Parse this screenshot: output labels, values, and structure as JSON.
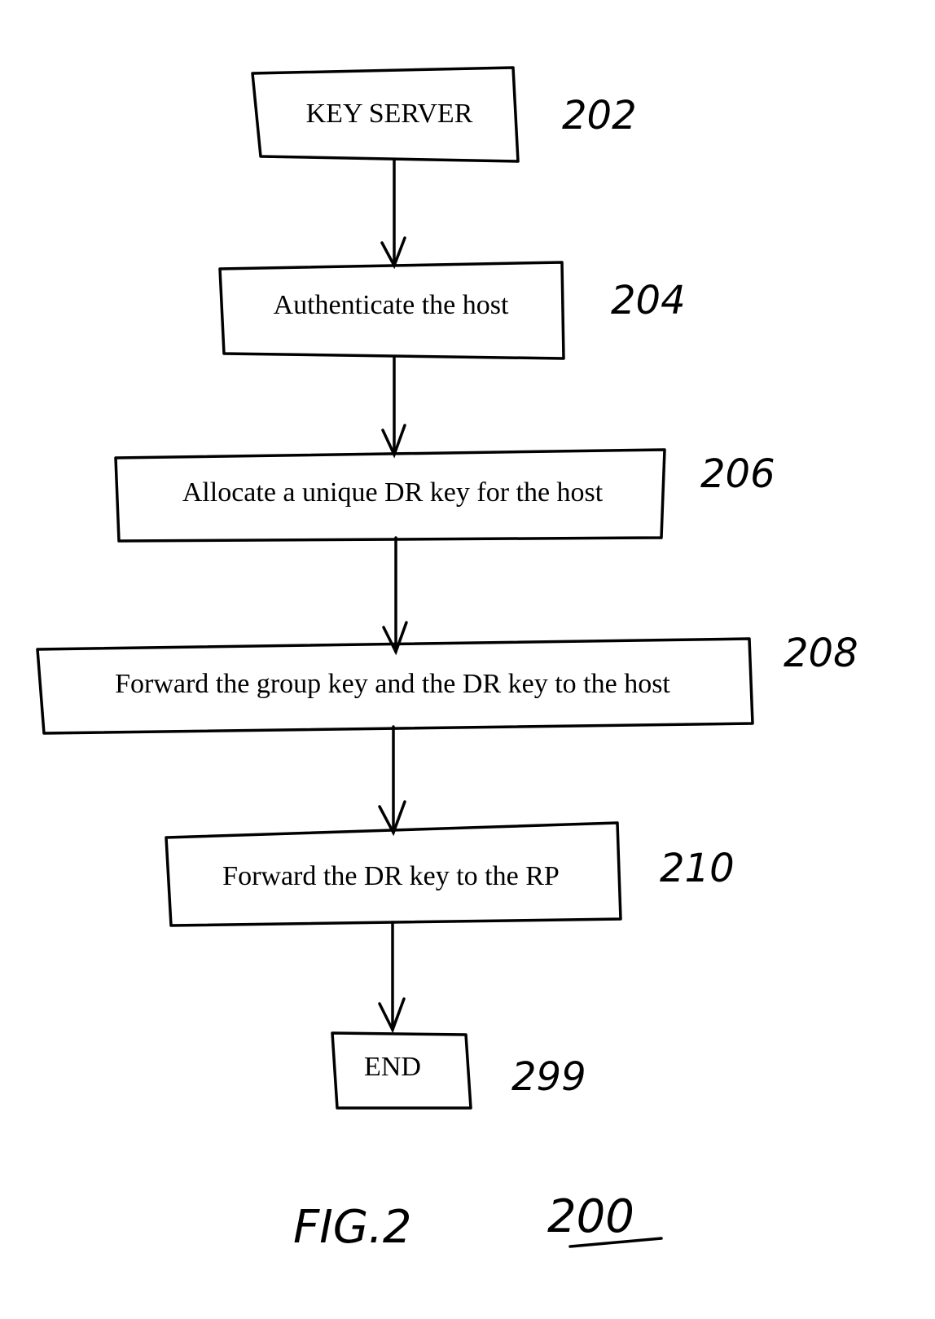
{
  "diagram": {
    "type": "flowchart",
    "steps": [
      {
        "id": "202",
        "label": "KEY SERVER",
        "ref": "202"
      },
      {
        "id": "204",
        "label": "Authenticate the host",
        "ref": "204"
      },
      {
        "id": "206",
        "label": "Allocate a unique DR key for the host",
        "ref": "206"
      },
      {
        "id": "208",
        "label": "Forward the group key and the DR key to the host",
        "ref": "208"
      },
      {
        "id": "210",
        "label": "Forward the DR key to the RP",
        "ref": "210"
      },
      {
        "id": "299",
        "label": "END",
        "ref": "299"
      }
    ],
    "edges": [
      {
        "from": "202",
        "to": "204"
      },
      {
        "from": "204",
        "to": "206"
      },
      {
        "from": "206",
        "to": "208"
      },
      {
        "from": "208",
        "to": "210"
      },
      {
        "from": "210",
        "to": "299"
      }
    ],
    "caption": {
      "figure": "FIG.2",
      "number": "200"
    }
  }
}
